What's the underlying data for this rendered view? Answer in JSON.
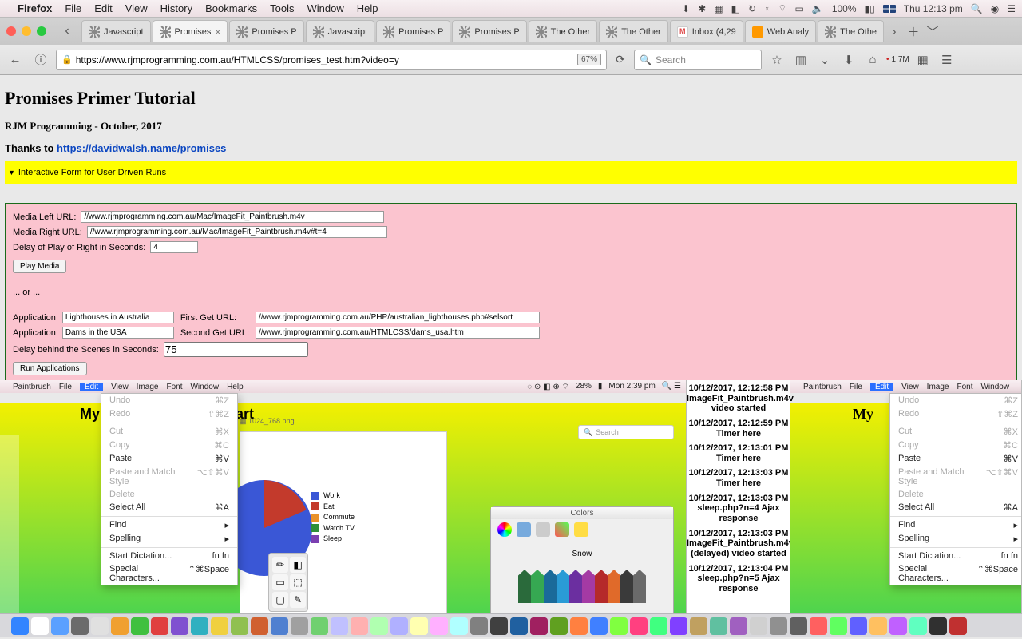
{
  "menubar": {
    "app": "Firefox",
    "items": [
      "File",
      "Edit",
      "View",
      "History",
      "Bookmarks",
      "Tools",
      "Window",
      "Help"
    ],
    "battery": "100%",
    "clock": "Thu 12:13 pm"
  },
  "tabs": [
    {
      "label": "Javascript",
      "icon": "gear"
    },
    {
      "label": "Promises",
      "icon": "gear",
      "active": true,
      "close": true
    },
    {
      "label": "Promises P",
      "icon": "gear"
    },
    {
      "label": "Javascript",
      "icon": "gear"
    },
    {
      "label": "Promises P",
      "icon": "gear"
    },
    {
      "label": "Promises P",
      "icon": "gear"
    },
    {
      "label": "The Other",
      "icon": "gear"
    },
    {
      "label": "The Other",
      "icon": "gear"
    },
    {
      "label": "Inbox (4,29",
      "icon": "gmail"
    },
    {
      "label": "Web Analy",
      "icon": "ga"
    },
    {
      "label": "The Othe",
      "icon": "gear"
    }
  ],
  "toolbar": {
    "url": "https://www.rjmprogramming.com.au/HTMLCSS/promises_test.htm?video=y",
    "zoom": "67%",
    "search_placeholder": "Search",
    "badge": "1.7M"
  },
  "page": {
    "title": "Promises Primer Tutorial",
    "subtitle": "RJM Programming - October, 2017",
    "thanks_prefix": "Thanks to ",
    "thanks_link": "https://davidwalsh.name/promises",
    "summary": "Interactive Form for User Driven Runs",
    "form": {
      "left_label": "Media Left URL:",
      "left_val": "//www.rjmprogramming.com.au/Mac/ImageFit_Paintbrush.m4v",
      "right_label": "Media Right URL:",
      "right_val": "//www.rjmprogramming.com.au/Mac/ImageFit_Paintbrush.m4v#t=4",
      "delay_label": "Delay of Play of Right in Seconds:",
      "delay_val": "4",
      "play_btn": "Play Media",
      "or": "... or ...",
      "app_label": "Application",
      "app1_val": "Lighthouses in Australia",
      "app2_val": "Dams in the USA",
      "get1_label": "First Get URL:",
      "get1_val": "//www.rjmprogramming.com.au/PHP/australian_lighthouses.php#selsort",
      "get2_label": "Second Get URL:",
      "get2_val": "//www.rjmprogramming.com.au/HTMLCSS/dams_usa.htm",
      "delay2_label": "Delay behind the Scenes in Seconds:",
      "delay2_val": "75",
      "run_btn": "Run Applications"
    }
  },
  "shots": {
    "mini_menu": {
      "app": "Paintbrush",
      "items": [
        "File",
        "Edit",
        "View",
        "Image",
        "Font",
        "Window",
        "Help"
      ],
      "edit": "Edit",
      "battery": "28%",
      "clock": "Mon 2:39 pm"
    },
    "dropdown": [
      {
        "t": "Undo",
        "s": "⌘Z",
        "d": true
      },
      {
        "t": "Redo",
        "s": "⇧⌘Z",
        "d": true
      },
      {
        "sep": true
      },
      {
        "t": "Cut",
        "s": "⌘X",
        "d": true
      },
      {
        "t": "Copy",
        "s": "⌘C",
        "d": true
      },
      {
        "t": "Paste",
        "s": "⌘V"
      },
      {
        "t": "Paste and Match Style",
        "s": "⌥⇧⌘V",
        "d": true
      },
      {
        "t": "Delete",
        "d": true
      },
      {
        "t": "Select All",
        "s": "⌘A"
      },
      {
        "sep": true
      },
      {
        "t": "Find",
        "s": "▸"
      },
      {
        "t": "Spelling",
        "s": "▸"
      },
      {
        "sep": true
      },
      {
        "t": "Start Dictation...",
        "s": "fn fn"
      },
      {
        "t": "Special Characters...",
        "s": "⌃⌘Space"
      }
    ],
    "chart_title_left": "My",
    "chart_title_right": "art",
    "finder_tab": "1024_768.png",
    "legend": [
      "Work",
      "Eat",
      "Commute",
      "Watch TV",
      "Sleep"
    ],
    "legend_colors": [
      "#3a57d6",
      "#c33a2c",
      "#e9922a",
      "#2f8f3a",
      "#7b3fb0"
    ],
    "search_ph": "Search",
    "colors_title": "Colors",
    "colors_sel": "Snow",
    "crayon_colors": [
      "#2a6a3b",
      "#36a852",
      "#1a6a9a",
      "#2a9bd6",
      "#6b2fa0",
      "#a43aa4",
      "#b52a2a",
      "#e06a2a",
      "#3a3a3a",
      "#6a6a6a"
    ]
  },
  "log": [
    {
      "t": "10/12/2017, 12:12:58 PM",
      "m": "ImageFit_Paintbrush.m4v video started"
    },
    {
      "t": "10/12/2017, 12:12:59 PM",
      "m": "Timer here"
    },
    {
      "t": "10/12/2017, 12:13:01 PM",
      "m": "Timer here"
    },
    {
      "t": "10/12/2017, 12:13:03 PM",
      "m": "Timer here"
    },
    {
      "t": "10/12/2017, 12:13:03 PM",
      "m": "sleep.php?n=4 Ajax response"
    },
    {
      "t": "10/12/2017, 12:13:03 PM",
      "m": "ImageFit_Paintbrush.m4v (delayed) video started"
    },
    {
      "t": "10/12/2017, 12:13:04 PM",
      "m": "sleep.php?n=5 Ajax response"
    }
  ],
  "dock_colors": [
    "#3284ff",
    "#fff",
    "#5aa0ff",
    "#6b6b6b",
    "#e0e0e0",
    "#f0a030",
    "#40c040",
    "#e04040",
    "#8050d0",
    "#30b0c0",
    "#f0d040",
    "#90c050",
    "#d06030",
    "#5080d0",
    "#a0a0a0",
    "#70d070",
    "#c0c0ff",
    "#ffb0b0",
    "#b0ffb0",
    "#b0b0ff",
    "#ffffb0",
    "#ffb0ff",
    "#b0ffff",
    "#808080",
    "#404040",
    "#2060a0",
    "#a02060",
    "#60a020",
    "#ff8040",
    "#4080ff",
    "#80ff40",
    "#ff4080",
    "#40ff80",
    "#8040ff",
    "#c0a060",
    "#60c0a0",
    "#a060c0",
    "#d0d0d0",
    "#909090",
    "#606060",
    "#ff6060",
    "#60ff60",
    "#6060ff",
    "#ffc060",
    "#c060ff",
    "#60ffc0",
    "#303030",
    "#c03030"
  ]
}
